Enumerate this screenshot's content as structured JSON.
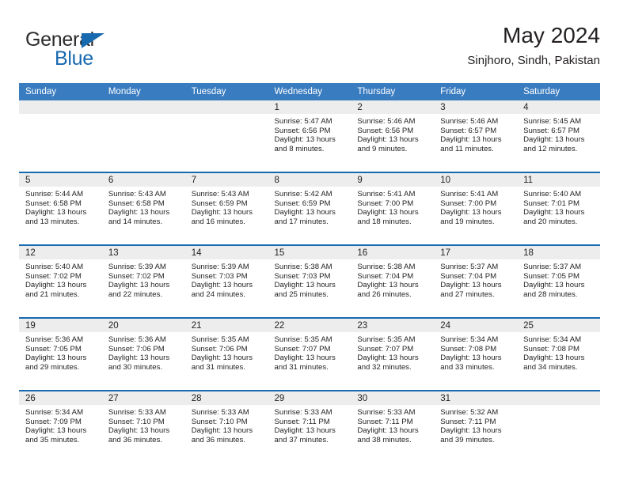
{
  "brand": {
    "name_top": "General",
    "name_bottom": "Blue",
    "color_blue": "#1769b0",
    "color_dark": "#2b2b2b"
  },
  "header": {
    "title": "May 2024",
    "subtitle": "Sinjhoro, Sindh, Pakistan"
  },
  "theme": {
    "header_bar": "#3a7cc0",
    "row_rule": "#1769b0",
    "daynum_band": "#ededed"
  },
  "calendar": {
    "weekday_headers": [
      "Sunday",
      "Monday",
      "Tuesday",
      "Wednesday",
      "Thursday",
      "Friday",
      "Saturday"
    ],
    "weeks": [
      [
        {
          "day": "",
          "empty": true
        },
        {
          "day": "",
          "empty": true
        },
        {
          "day": "",
          "empty": true
        },
        {
          "day": "1",
          "sunrise": "Sunrise: 5:47 AM",
          "sunset": "Sunset: 6:56 PM",
          "daylight1": "Daylight: 13 hours",
          "daylight2": "and 8 minutes."
        },
        {
          "day": "2",
          "sunrise": "Sunrise: 5:46 AM",
          "sunset": "Sunset: 6:56 PM",
          "daylight1": "Daylight: 13 hours",
          "daylight2": "and 9 minutes."
        },
        {
          "day": "3",
          "sunrise": "Sunrise: 5:46 AM",
          "sunset": "Sunset: 6:57 PM",
          "daylight1": "Daylight: 13 hours",
          "daylight2": "and 11 minutes."
        },
        {
          "day": "4",
          "sunrise": "Sunrise: 5:45 AM",
          "sunset": "Sunset: 6:57 PM",
          "daylight1": "Daylight: 13 hours",
          "daylight2": "and 12 minutes."
        }
      ],
      [
        {
          "day": "5",
          "sunrise": "Sunrise: 5:44 AM",
          "sunset": "Sunset: 6:58 PM",
          "daylight1": "Daylight: 13 hours",
          "daylight2": "and 13 minutes."
        },
        {
          "day": "6",
          "sunrise": "Sunrise: 5:43 AM",
          "sunset": "Sunset: 6:58 PM",
          "daylight1": "Daylight: 13 hours",
          "daylight2": "and 14 minutes."
        },
        {
          "day": "7",
          "sunrise": "Sunrise: 5:43 AM",
          "sunset": "Sunset: 6:59 PM",
          "daylight1": "Daylight: 13 hours",
          "daylight2": "and 16 minutes."
        },
        {
          "day": "8",
          "sunrise": "Sunrise: 5:42 AM",
          "sunset": "Sunset: 6:59 PM",
          "daylight1": "Daylight: 13 hours",
          "daylight2": "and 17 minutes."
        },
        {
          "day": "9",
          "sunrise": "Sunrise: 5:41 AM",
          "sunset": "Sunset: 7:00 PM",
          "daylight1": "Daylight: 13 hours",
          "daylight2": "and 18 minutes."
        },
        {
          "day": "10",
          "sunrise": "Sunrise: 5:41 AM",
          "sunset": "Sunset: 7:00 PM",
          "daylight1": "Daylight: 13 hours",
          "daylight2": "and 19 minutes."
        },
        {
          "day": "11",
          "sunrise": "Sunrise: 5:40 AM",
          "sunset": "Sunset: 7:01 PM",
          "daylight1": "Daylight: 13 hours",
          "daylight2": "and 20 minutes."
        }
      ],
      [
        {
          "day": "12",
          "sunrise": "Sunrise: 5:40 AM",
          "sunset": "Sunset: 7:02 PM",
          "daylight1": "Daylight: 13 hours",
          "daylight2": "and 21 minutes."
        },
        {
          "day": "13",
          "sunrise": "Sunrise: 5:39 AM",
          "sunset": "Sunset: 7:02 PM",
          "daylight1": "Daylight: 13 hours",
          "daylight2": "and 22 minutes."
        },
        {
          "day": "14",
          "sunrise": "Sunrise: 5:39 AM",
          "sunset": "Sunset: 7:03 PM",
          "daylight1": "Daylight: 13 hours",
          "daylight2": "and 24 minutes."
        },
        {
          "day": "15",
          "sunrise": "Sunrise: 5:38 AM",
          "sunset": "Sunset: 7:03 PM",
          "daylight1": "Daylight: 13 hours",
          "daylight2": "and 25 minutes."
        },
        {
          "day": "16",
          "sunrise": "Sunrise: 5:38 AM",
          "sunset": "Sunset: 7:04 PM",
          "daylight1": "Daylight: 13 hours",
          "daylight2": "and 26 minutes."
        },
        {
          "day": "17",
          "sunrise": "Sunrise: 5:37 AM",
          "sunset": "Sunset: 7:04 PM",
          "daylight1": "Daylight: 13 hours",
          "daylight2": "and 27 minutes."
        },
        {
          "day": "18",
          "sunrise": "Sunrise: 5:37 AM",
          "sunset": "Sunset: 7:05 PM",
          "daylight1": "Daylight: 13 hours",
          "daylight2": "and 28 minutes."
        }
      ],
      [
        {
          "day": "19",
          "sunrise": "Sunrise: 5:36 AM",
          "sunset": "Sunset: 7:05 PM",
          "daylight1": "Daylight: 13 hours",
          "daylight2": "and 29 minutes."
        },
        {
          "day": "20",
          "sunrise": "Sunrise: 5:36 AM",
          "sunset": "Sunset: 7:06 PM",
          "daylight1": "Daylight: 13 hours",
          "daylight2": "and 30 minutes."
        },
        {
          "day": "21",
          "sunrise": "Sunrise: 5:35 AM",
          "sunset": "Sunset: 7:06 PM",
          "daylight1": "Daylight: 13 hours",
          "daylight2": "and 31 minutes."
        },
        {
          "day": "22",
          "sunrise": "Sunrise: 5:35 AM",
          "sunset": "Sunset: 7:07 PM",
          "daylight1": "Daylight: 13 hours",
          "daylight2": "and 31 minutes."
        },
        {
          "day": "23",
          "sunrise": "Sunrise: 5:35 AM",
          "sunset": "Sunset: 7:07 PM",
          "daylight1": "Daylight: 13 hours",
          "daylight2": "and 32 minutes."
        },
        {
          "day": "24",
          "sunrise": "Sunrise: 5:34 AM",
          "sunset": "Sunset: 7:08 PM",
          "daylight1": "Daylight: 13 hours",
          "daylight2": "and 33 minutes."
        },
        {
          "day": "25",
          "sunrise": "Sunrise: 5:34 AM",
          "sunset": "Sunset: 7:08 PM",
          "daylight1": "Daylight: 13 hours",
          "daylight2": "and 34 minutes."
        }
      ],
      [
        {
          "day": "26",
          "sunrise": "Sunrise: 5:34 AM",
          "sunset": "Sunset: 7:09 PM",
          "daylight1": "Daylight: 13 hours",
          "daylight2": "and 35 minutes."
        },
        {
          "day": "27",
          "sunrise": "Sunrise: 5:33 AM",
          "sunset": "Sunset: 7:10 PM",
          "daylight1": "Daylight: 13 hours",
          "daylight2": "and 36 minutes."
        },
        {
          "day": "28",
          "sunrise": "Sunrise: 5:33 AM",
          "sunset": "Sunset: 7:10 PM",
          "daylight1": "Daylight: 13 hours",
          "daylight2": "and 36 minutes."
        },
        {
          "day": "29",
          "sunrise": "Sunrise: 5:33 AM",
          "sunset": "Sunset: 7:11 PM",
          "daylight1": "Daylight: 13 hours",
          "daylight2": "and 37 minutes."
        },
        {
          "day": "30",
          "sunrise": "Sunrise: 5:33 AM",
          "sunset": "Sunset: 7:11 PM",
          "daylight1": "Daylight: 13 hours",
          "daylight2": "and 38 minutes."
        },
        {
          "day": "31",
          "sunrise": "Sunrise: 5:32 AM",
          "sunset": "Sunset: 7:11 PM",
          "daylight1": "Daylight: 13 hours",
          "daylight2": "and 39 minutes."
        },
        {
          "day": "",
          "empty": true
        }
      ]
    ]
  }
}
